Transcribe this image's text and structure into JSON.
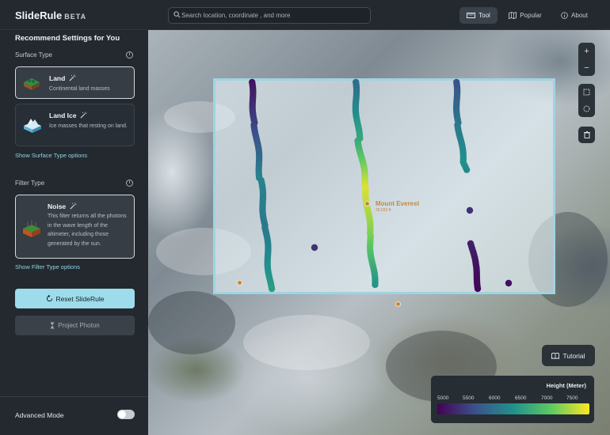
{
  "app": {
    "name": "SlideRule",
    "badge": "BETA"
  },
  "search": {
    "placeholder": "Search location, coordinate , and more"
  },
  "nav": {
    "tool": "Tool",
    "popular": "Popular",
    "about": "About"
  },
  "sidebar": {
    "title": "Recommend Settings for You",
    "surface": {
      "label": "Surface Type",
      "cards": [
        {
          "title": "Land",
          "desc": "Continental land masses",
          "selected": true,
          "icon": "land-icon"
        },
        {
          "title": "Land Ice",
          "desc": "Ice masses that resting on land.",
          "selected": false,
          "icon": "ice-icon"
        }
      ],
      "link": "Show Surface Type options"
    },
    "filter": {
      "label": "Filter Type",
      "card": {
        "title": "Noise",
        "desc": "This filter returns all the photons in the wave length of the altimeter, including those generated by the sun."
      },
      "link": "Show Filter Type options"
    },
    "reset_label": "Reset SlideRule",
    "photon_label": "Project Photon",
    "advanced_label": "Advanced Mode",
    "advanced_on": false
  },
  "map": {
    "peak": {
      "name": "Mount Everest",
      "elevation": "29,032 ft"
    },
    "tutorial_label": "Tutorial",
    "legend": {
      "title": "Height (Meter)",
      "ticks": [
        "5000",
        "5500",
        "6000",
        "6500",
        "7000",
        "7500"
      ],
      "colors": [
        "#440154",
        "#3b528b",
        "#21918c",
        "#5ec962",
        "#fde725"
      ]
    }
  },
  "colors": {
    "accent": "#9ddcea",
    "link": "#8fd4e3",
    "selection": "#9ed4e2"
  }
}
